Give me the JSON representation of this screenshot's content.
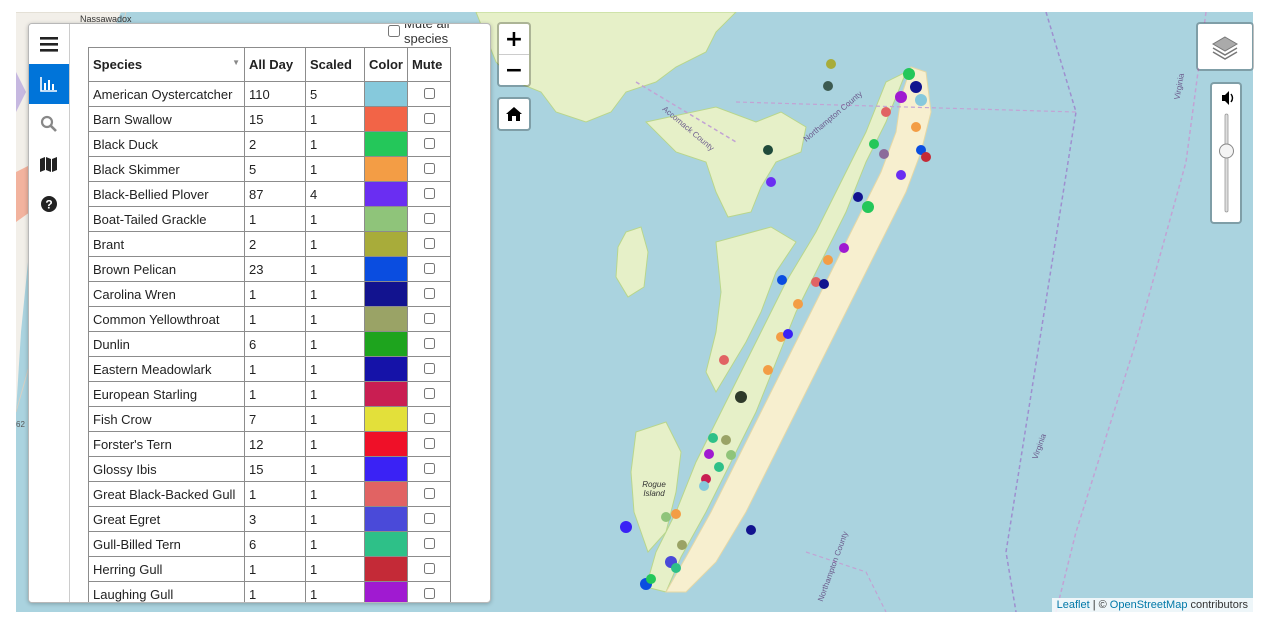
{
  "map": {
    "labels": {
      "nassawadox": "Nassawadox",
      "rogue_island": "Rogue Island",
      "accomack_county": "Accomack County",
      "northampton_county_1": "Northampton County",
      "northampton_county_2": "Northampton County",
      "virginia_1": "Virginia",
      "virginia_2": "Virginia",
      "side_62": "62"
    },
    "zoom_in_label": "+",
    "zoom_out_label": "−",
    "attribution": {
      "leaflet": "Leaflet",
      "separator": "| ©",
      "osm": "OpenStreetMap",
      "contributors": "contributors"
    }
  },
  "sidebar": {
    "tabs": [
      {
        "name": "menu-icon",
        "active": false
      },
      {
        "name": "bar-chart-icon",
        "active": true
      },
      {
        "name": "search-icon",
        "active": false
      },
      {
        "name": "map-icon",
        "active": false
      },
      {
        "name": "help-icon",
        "active": false
      }
    ],
    "mute_all_label": "Mute all species",
    "table": {
      "headers": {
        "species": "Species",
        "all_day": "All Day",
        "scaled": "Scaled",
        "color": "Color",
        "mute": "Mute"
      },
      "rows": [
        {
          "species": "American Oystercatcher",
          "all_day": "110",
          "scaled": "5",
          "color": "#86c9dc"
        },
        {
          "species": "Barn Swallow",
          "all_day": "15",
          "scaled": "1",
          "color": "#f26447"
        },
        {
          "species": "Black Duck",
          "all_day": "2",
          "scaled": "1",
          "color": "#24c75a"
        },
        {
          "species": "Black Skimmer",
          "all_day": "5",
          "scaled": "1",
          "color": "#f39d45"
        },
        {
          "species": "Black-Bellied Plover",
          "all_day": "87",
          "scaled": "4",
          "color": "#6a2ef2"
        },
        {
          "species": "Boat-Tailed Grackle",
          "all_day": "1",
          "scaled": "1",
          "color": "#8fc47a"
        },
        {
          "species": "Brant",
          "all_day": "2",
          "scaled": "1",
          "color": "#a8ac3a"
        },
        {
          "species": "Brown Pelican",
          "all_day": "23",
          "scaled": "1",
          "color": "#0a4de0"
        },
        {
          "species": "Carolina Wren",
          "all_day": "1",
          "scaled": "1",
          "color": "#12138f"
        },
        {
          "species": "Common Yellowthroat",
          "all_day": "1",
          "scaled": "1",
          "color": "#9aa366"
        },
        {
          "species": "Dunlin",
          "all_day": "6",
          "scaled": "1",
          "color": "#1ea41e"
        },
        {
          "species": "Eastern Meadowlark",
          "all_day": "1",
          "scaled": "1",
          "color": "#1512a8"
        },
        {
          "species": "European Starling",
          "all_day": "1",
          "scaled": "1",
          "color": "#c91e52"
        },
        {
          "species": "Fish Crow",
          "all_day": "7",
          "scaled": "1",
          "color": "#e3e03a"
        },
        {
          "species": "Forster's Tern",
          "all_day": "12",
          "scaled": "1",
          "color": "#ef1028"
        },
        {
          "species": "Glossy Ibis",
          "all_day": "15",
          "scaled": "1",
          "color": "#3a22f5"
        },
        {
          "species": "Great Black-Backed Gull",
          "all_day": "1",
          "scaled": "1",
          "color": "#e16363"
        },
        {
          "species": "Great Egret",
          "all_day": "3",
          "scaled": "1",
          "color": "#4a4ad9"
        },
        {
          "species": "Gull-Billed Tern",
          "all_day": "6",
          "scaled": "1",
          "color": "#2ec088"
        },
        {
          "species": "Herring Gull",
          "all_day": "1",
          "scaled": "1",
          "color": "#c42a37"
        },
        {
          "species": "Laughing Gull",
          "all_day": "1",
          "scaled": "1",
          "color": "#a01ad1"
        }
      ]
    }
  }
}
